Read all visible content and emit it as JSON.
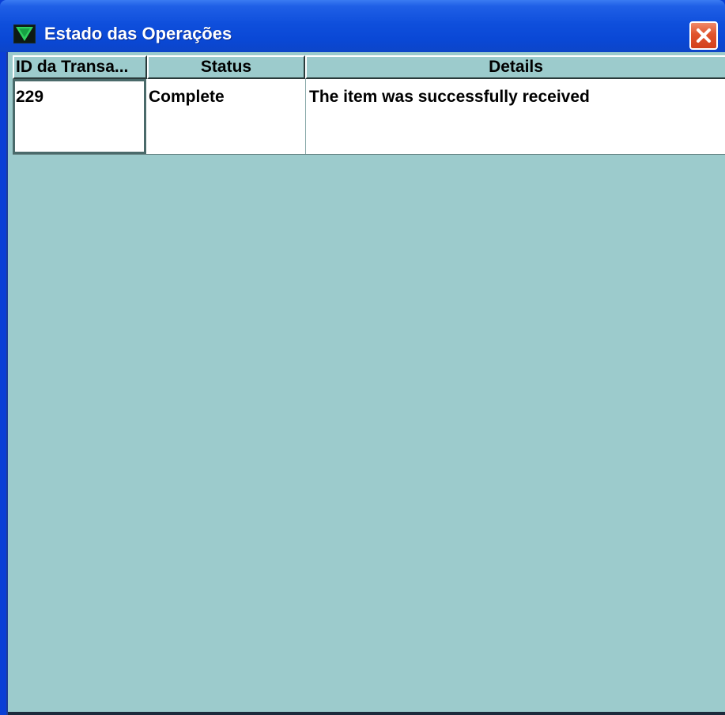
{
  "window": {
    "title": "Estado das Operações",
    "close_label": "✕"
  },
  "table": {
    "columns": [
      "ID da Transa...",
      "Status",
      "Details"
    ],
    "rows": [
      {
        "id": "229",
        "status": "Complete",
        "details": "The item was successfully received"
      }
    ]
  },
  "colors": {
    "titlebar": "#0a48d6",
    "client_background": "#9ccbcc",
    "close_button": "#e0532c",
    "row_background": "#ffffff"
  },
  "icons": {
    "app": "green-triangle-icon",
    "close": "close-icon"
  }
}
